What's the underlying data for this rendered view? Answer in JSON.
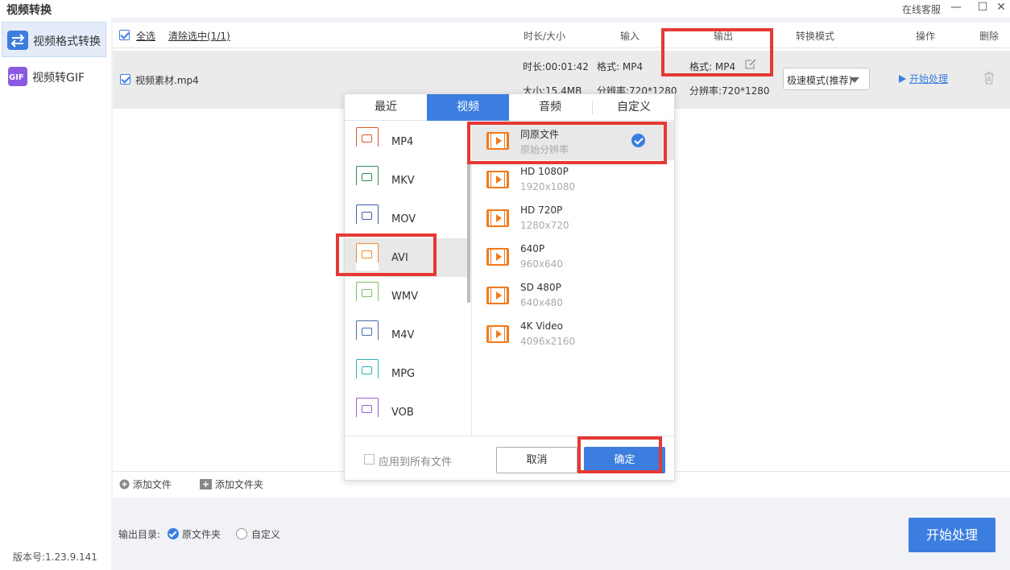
{
  "window": {
    "title": "视频转换",
    "support": "在线客服",
    "minimize": "—",
    "maximize": "☐",
    "close": "✕"
  },
  "sidebar": {
    "items": [
      {
        "label": "视频格式转换",
        "icon": "swap-arrows-icon",
        "color": "#3b7ee0"
      },
      {
        "label": "视频转GIF",
        "icon": "gif-icon",
        "color": "#8a5be0",
        "icon_text": "GIF"
      }
    ],
    "version": "版本号:1.23.9.141"
  },
  "table": {
    "header": {
      "select_all": "全选",
      "clear_selected": "清除选中(1/1)",
      "duration_size": "时长/大小",
      "input": "输入",
      "output": "输出",
      "mode": "转换模式",
      "action": "操作",
      "delete": "删除"
    },
    "row": {
      "filename": "视频素材.mp4",
      "duration": "时长:00:01:42",
      "size": "大小:15.4MB",
      "input_format": "格式: MP4",
      "input_resolution": "分辨率:720*1280",
      "output_format": "格式: MP4",
      "output_resolution": "分辨率:720*1280",
      "mode": "极速模式(推荐)",
      "start": "开始处理"
    },
    "footer": {
      "add_file": "添加文件",
      "add_folder": "添加文件夹"
    }
  },
  "output_dir": {
    "label": "输出目录:",
    "option_original": "原文件夹",
    "option_custom": "自定义"
  },
  "start_button": "开始处理",
  "popup": {
    "tabs": [
      "最近",
      "视频",
      "音频",
      "自定义"
    ],
    "active_tab": "视频",
    "formats": [
      {
        "label": "MP4",
        "band": "MP4",
        "color": "#e0562a"
      },
      {
        "label": "MKV",
        "band": "MKV",
        "color": "#2e8b57"
      },
      {
        "label": "MOV",
        "band": "MOV",
        "color": "#3a5fa8"
      },
      {
        "label": "AVI",
        "band": "AVI",
        "color": "#f08a24"
      },
      {
        "label": "WMV",
        "band": "WMV",
        "color": "#7cc06a"
      },
      {
        "label": "M4V",
        "band": "M4V",
        "color": "#4a6db0"
      },
      {
        "label": "MPG",
        "band": "MPG",
        "color": "#2bb3b3"
      },
      {
        "label": "VOB",
        "band": "VOB",
        "color": "#9b5fd6"
      }
    ],
    "selected_format": "AVI",
    "resolutions": [
      {
        "name": "同原文件",
        "sub": "原始分辨率"
      },
      {
        "name": "HD 1080P",
        "sub": "1920x1080"
      },
      {
        "name": "HD 720P",
        "sub": "1280x720"
      },
      {
        "name": "640P",
        "sub": "960x640"
      },
      {
        "name": "SD 480P",
        "sub": "640x480"
      },
      {
        "name": "4K Video",
        "sub": "4096x2160"
      }
    ],
    "selected_resolution": "同原文件",
    "apply_all": "应用到所有文件",
    "cancel": "取消",
    "ok": "确定"
  },
  "colors": {
    "accent": "#3b7ee0",
    "highlight": "#e53935",
    "film_icon": "#f07a1e"
  }
}
